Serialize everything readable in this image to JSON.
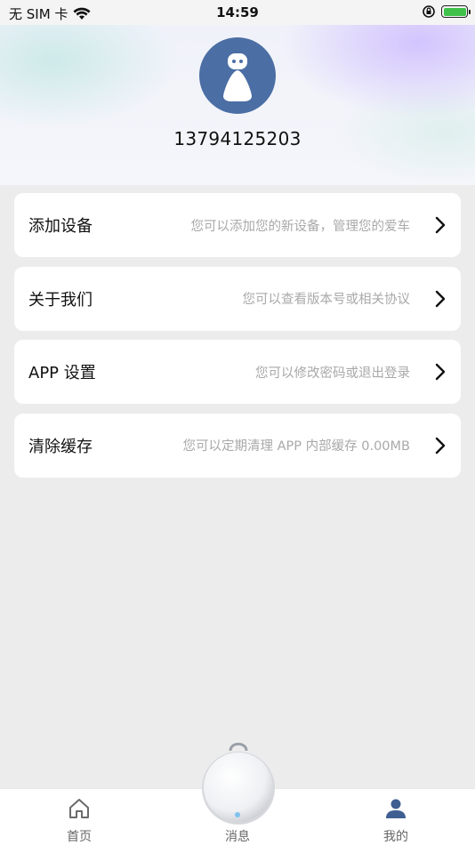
{
  "status_bar": {
    "carrier": "无 SIM 卡",
    "time": "14:59"
  },
  "profile": {
    "phone": "13794125203"
  },
  "menu": [
    {
      "title": "添加设备",
      "description": "您可以添加您的新设备，管理您的爱车"
    },
    {
      "title": "关于我们",
      "description": "您可以查看版本号或相关协议"
    },
    {
      "title": "APP 设置",
      "description": "您可以修改密码或退出登录"
    },
    {
      "title": "清除缓存",
      "description": "您可以定期清理 APP 内部缓存 0.00MB"
    }
  ],
  "tabs": [
    {
      "label": "首页",
      "icon": "home-icon"
    },
    {
      "label": "消息",
      "icon": "device-icon"
    },
    {
      "label": "我的",
      "icon": "person-icon"
    }
  ],
  "colors": {
    "accent": "#3f5f92",
    "avatar_bg": "#4b6ea4",
    "battery": "#3ec24a"
  }
}
